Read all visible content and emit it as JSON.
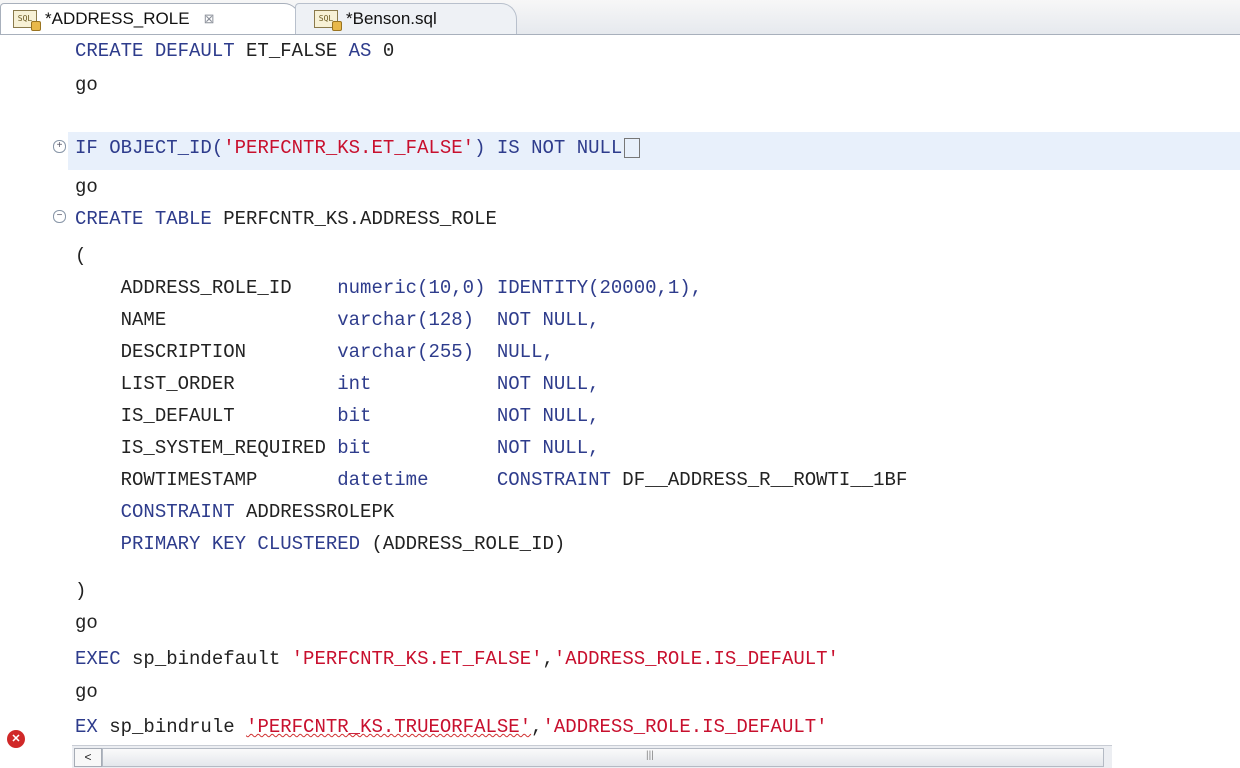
{
  "tabs": [
    {
      "label": "*ADDRESS_ROLE",
      "icon": "sql-file-icon",
      "active": true,
      "close": "⊠"
    },
    {
      "label": "*Benson.sql",
      "icon": "sql-file-icon",
      "active": false
    }
  ],
  "icon_text": "SQL",
  "colors": {
    "keyword": "#2e3c8c",
    "string": "#c8102e",
    "error": "#d02828",
    "highlight": "#e8f0fb"
  },
  "code": {
    "l1a": "CREATE DEFAULT ",
    "l1b": "ET_FALSE ",
    "l1c": "AS ",
    "l1d": "0",
    "l2": "go",
    "l3a": "IF OBJECT_ID(",
    "l3b": "'PERFCNTR_KS.ET_FALSE'",
    "l3c": ") IS NOT NULL",
    "l4": "go",
    "l5a": "CREATE TABLE ",
    "l5b": "PERFCNTR_KS.ADDRESS_ROLE",
    "l6": "(",
    "l7a": "    ADDRESS_ROLE_ID    ",
    "l7b": "numeric(10,0) IDENTITY(20000,1),",
    "l8a": "    NAME               ",
    "l8b": "varchar(128)  NOT NULL,",
    "l9a": "    DESCRIPTION        ",
    "l9b": "varchar(255)  NULL,",
    "l10a": "    LIST_ORDER         ",
    "l10b": "int           NOT NULL,",
    "l11a": "    IS_DEFAULT         ",
    "l11b": "bit           NOT NULL,",
    "l12a": "    IS_SYSTEM_REQUIRED ",
    "l12b": "bit           NOT NULL,",
    "l13a": "    ROWTIMESTAMP       ",
    "l13b": "datetime      CONSTRAINT ",
    "l13c": "DF__ADDRESS_R__ROWTI__1BF",
    "l14a": "    CONSTRAINT ",
    "l14b": "ADDRESSROLEPK",
    "l15a": "    PRIMARY KEY CLUSTERED ",
    "l15b": "(ADDRESS_ROLE_ID)",
    "l16": ")",
    "l17": "go",
    "l18a": "EXEC ",
    "l18b": "sp_bindefault ",
    "l18c": "'PERFCNTR_KS.ET_FALSE'",
    "l18d": ",",
    "l18e": "'ADDRESS_ROLE.IS_DEFAULT'",
    "l19": "go",
    "l20a": "EX ",
    "l20b": "sp_bindrule ",
    "l20c": "'PERFCNTR_KS.TRUEORFALSE'",
    "l20d": ",",
    "l20e": "'ADDRESS_ROLE.IS_DEFAULT'"
  },
  "gutter": {
    "expand": "+",
    "collapse": "−",
    "error": "✕"
  },
  "scroll": {
    "left": "<",
    "grip": "|||"
  }
}
